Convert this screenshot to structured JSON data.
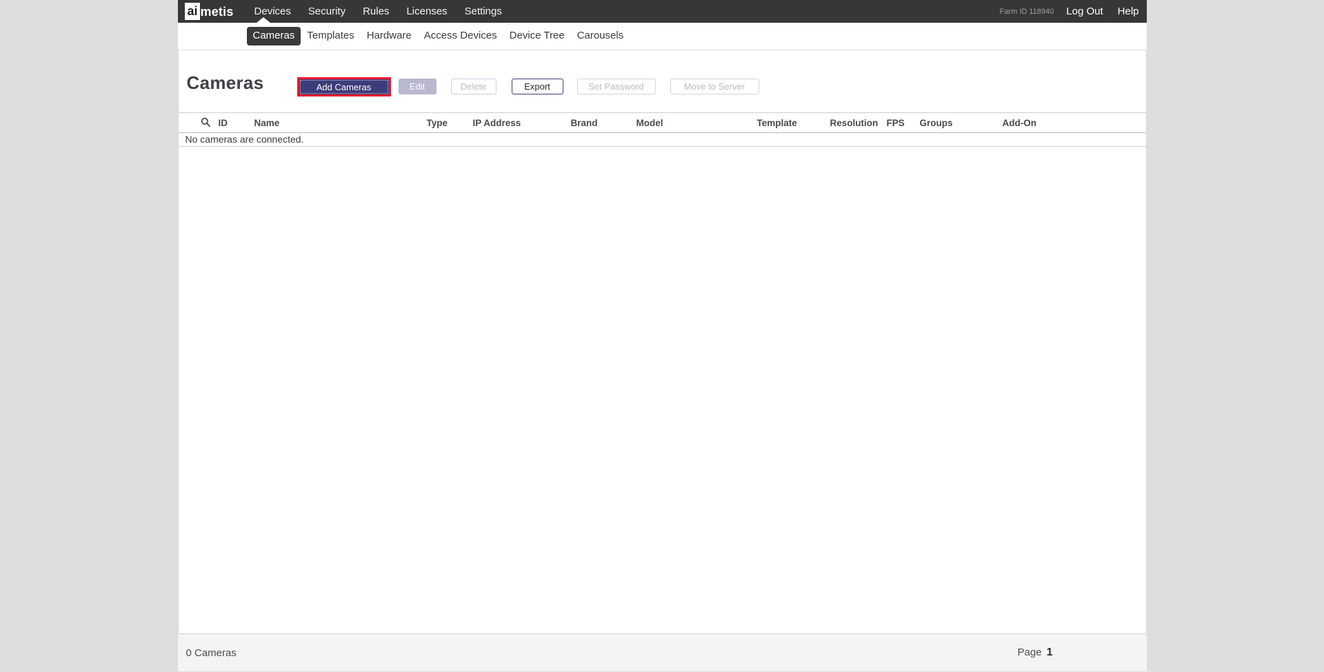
{
  "topbar": {
    "logo": {
      "prefix": "ai",
      "suffix": "metis"
    },
    "nav": [
      {
        "label": "Devices",
        "active": true
      },
      {
        "label": "Security",
        "active": false
      },
      {
        "label": "Rules",
        "active": false
      },
      {
        "label": "Licenses",
        "active": false
      },
      {
        "label": "Settings",
        "active": false
      }
    ],
    "farm_id": "Farm ID 118940",
    "logout_label": "Log Out",
    "help_label": "Help"
  },
  "subnav": {
    "tabs": [
      {
        "label": "Cameras",
        "active": true
      },
      {
        "label": "Templates",
        "active": false
      },
      {
        "label": "Hardware",
        "active": false
      },
      {
        "label": "Access Devices",
        "active": false
      },
      {
        "label": "Device Tree",
        "active": false
      },
      {
        "label": "Carousels",
        "active": false
      }
    ]
  },
  "main": {
    "title": "Cameras",
    "toolbar": {
      "add_cameras": "Add Cameras",
      "edit": "Edit",
      "delete": "Delete",
      "export": "Export",
      "set_password": "Set Password",
      "move_to_server": "Move to Server"
    },
    "table": {
      "columns": [
        "ID",
        "Name",
        "Type",
        "IP Address",
        "Brand",
        "Model",
        "Template",
        "Resolution",
        "FPS",
        "Groups",
        "Add-On"
      ],
      "empty_message": "No cameras are connected."
    }
  },
  "footer": {
    "count": "0 Cameras",
    "page_label": "Page",
    "page_number": "1"
  },
  "icons": {
    "search": "search-icon"
  },
  "colors": {
    "topbar_bg": "#373737",
    "accent_navy": "#3d3c7a",
    "highlight_red": "#e9192d",
    "page_bg": "#dedede",
    "panel_bg": "#ffffff",
    "footer_bg": "#f4f4f4",
    "disabled_fill": "#b9b8cf"
  }
}
